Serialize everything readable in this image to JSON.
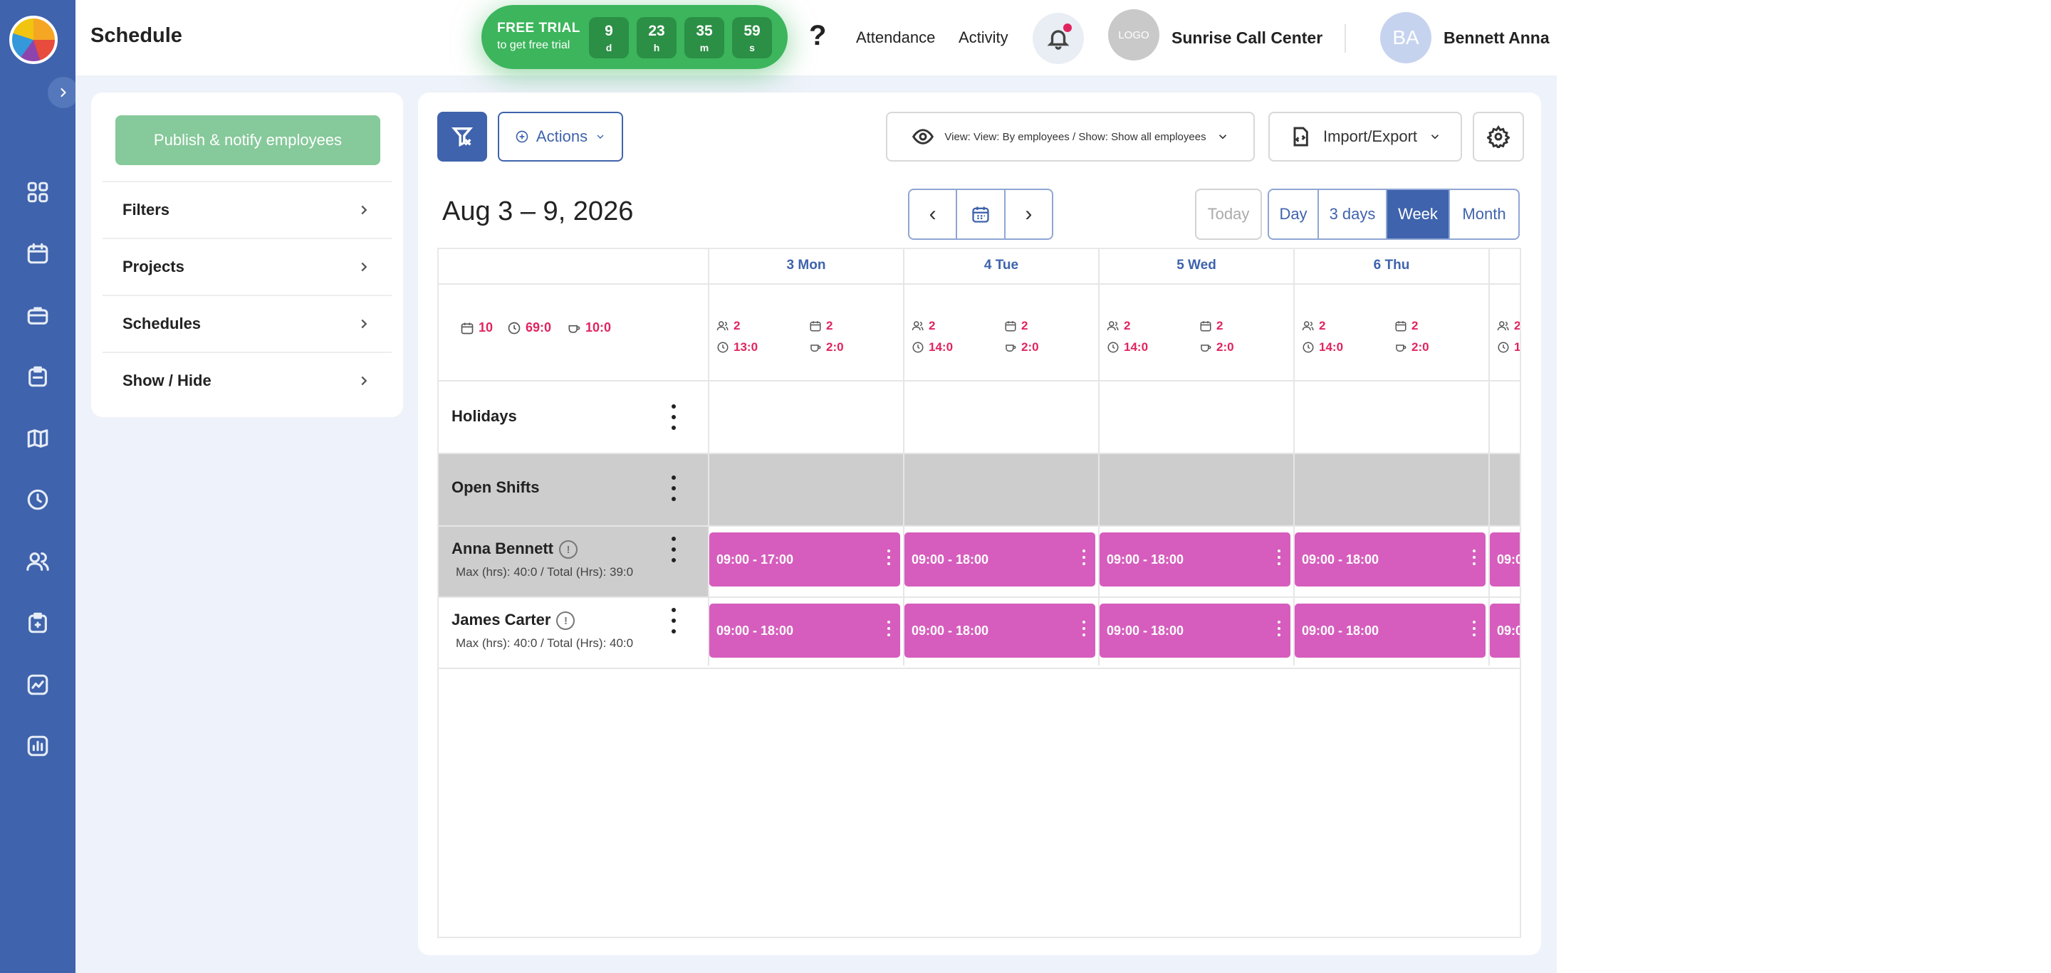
{
  "page": {
    "title": "Schedule"
  },
  "trial": {
    "title": "FREE TRIAL",
    "subtitle": "to get free trial",
    "days": "9",
    "days_unit": "d",
    "hours": "23",
    "hours_unit": "h",
    "minutes": "35",
    "minutes_unit": "m",
    "seconds": "59",
    "seconds_unit": "s"
  },
  "topbar": {
    "help": "?",
    "attendance": "Attendance",
    "activity": "Activity",
    "company_logo": "LOGO",
    "company": "Sunrise Call Center",
    "avatar_initials": "BA",
    "user": "Bennett Anna"
  },
  "sidebar_icons": [
    "dashboard-icon",
    "calendar-icon",
    "briefcase-icon",
    "clipboard-icon",
    "map-icon",
    "clock-icon",
    "users-icon",
    "task-icon",
    "chart-line-icon",
    "report-icon"
  ],
  "left_panel": {
    "publish": "Publish & notify employees",
    "sections": [
      "Filters",
      "Projects",
      "Schedules",
      "Show / Hide"
    ]
  },
  "toolbar": {
    "actions": "Actions",
    "view": "View: View: By employees",
    "view_sep": "/",
    "show": "Show: Show all employees",
    "import_export": "Import/Export"
  },
  "calendar": {
    "range": "Aug 3 – 9, 2026",
    "prev": "‹",
    "next": "›",
    "today": "Today",
    "views": [
      "Day",
      "3 days",
      "Week",
      "Month"
    ],
    "active_view": "Week",
    "days": [
      "3 Mon",
      "4 Tue",
      "5 Wed",
      "6 Thu"
    ],
    "summary": {
      "shifts": "10",
      "hours": "69:0",
      "breaks": "10:0"
    },
    "day_stats": [
      {
        "people": "2",
        "shifts": "2",
        "hours": "13:0",
        "breaks": "2:0"
      },
      {
        "people": "2",
        "shifts": "2",
        "hours": "14:0",
        "breaks": "2:0"
      },
      {
        "people": "2",
        "shifts": "2",
        "hours": "14:0",
        "breaks": "2:0"
      },
      {
        "people": "2",
        "shifts": "2",
        "hours": "14:0",
        "breaks": "2:0"
      },
      {
        "people": "2",
        "shifts": "",
        "hours": "1",
        "breaks": ""
      }
    ],
    "rows": {
      "holidays": "Holidays",
      "open_shifts": "Open Shifts"
    },
    "employees": [
      {
        "name": "Anna Bennett",
        "info": "!",
        "sub": "Max (hrs): 40:0 / Total (Hrs): 39:0",
        "shifts": [
          "09:00 - 17:00",
          "09:00 - 18:00",
          "09:00 - 18:00",
          "09:00 - 18:00",
          "09:0"
        ]
      },
      {
        "name": "James Carter",
        "info": "!",
        "sub": "Max (hrs): 40:0 / Total (Hrs): 40:0",
        "shifts": [
          "09:00 - 18:00",
          "09:00 - 18:00",
          "09:00 - 18:00",
          "09:00 - 18:00",
          "09:0"
        ]
      }
    ]
  },
  "colors": {
    "nav": "#3f63ac",
    "trial": "#3cb55c",
    "shift": "#d65dbd",
    "alert": "#e0245e",
    "publish": "#86c99a"
  }
}
